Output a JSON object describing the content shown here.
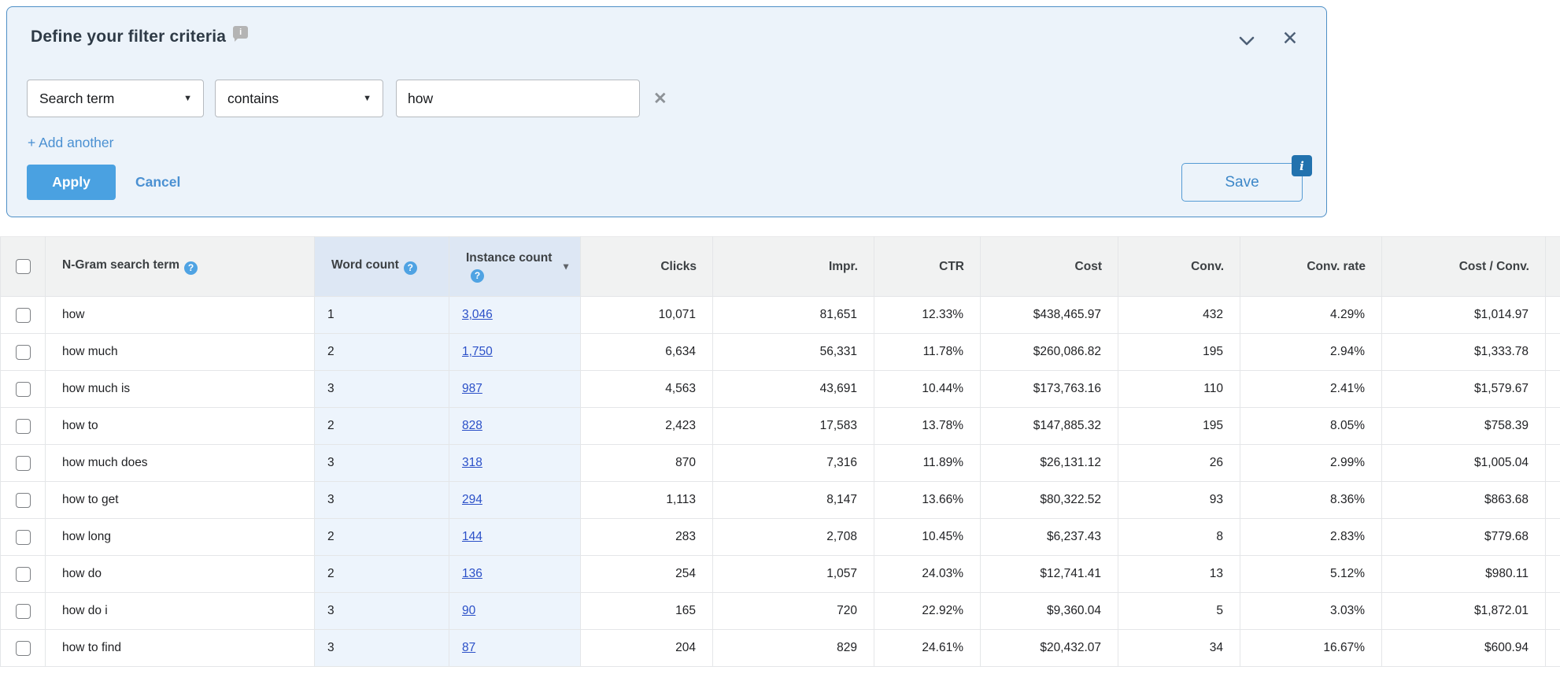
{
  "filter_panel": {
    "title": "Define your filter criteria",
    "criteria_row": {
      "field": "Search term",
      "operator": "contains",
      "value": "how"
    },
    "add_another_label": "+ Add another",
    "apply_label": "Apply",
    "cancel_label": "Cancel",
    "save_label": "Save"
  },
  "icons": {
    "help": "?",
    "info": "i",
    "save_info": "i",
    "sort_desc": "▼",
    "dropdown_arrow": "▼",
    "close": "✕",
    "remove": "✕"
  },
  "colors": {
    "panel_bg": "#ecf3fa",
    "panel_border": "#4e8fc6",
    "accent_blue": "#4a90d2",
    "apply_bg": "#4aa1e1",
    "table_link": "#2b50c8",
    "header_bg": "#f1f2f2",
    "highlight_col_header": "#dde7f4",
    "highlight_col_body": "#edf4fc"
  },
  "table": {
    "header": {
      "term": "N-Gram search term",
      "word_count": "Word count",
      "instance_count": "Instance count",
      "clicks": "Clicks",
      "impr": "Impr.",
      "ctr": "CTR",
      "cost": "Cost",
      "conv": "Conv.",
      "conv_rate": "Conv. rate",
      "cost_conv": "Cost / Conv."
    },
    "rows": [
      {
        "term": "how",
        "word_count": "1",
        "instance_count": "3,046",
        "clicks": "10,071",
        "impr": "81,651",
        "ctr": "12.33%",
        "cost": "$438,465.97",
        "conv": "432",
        "conv_rate": "4.29%",
        "cost_conv": "$1,014.97"
      },
      {
        "term": "how much",
        "word_count": "2",
        "instance_count": "1,750",
        "clicks": "6,634",
        "impr": "56,331",
        "ctr": "11.78%",
        "cost": "$260,086.82",
        "conv": "195",
        "conv_rate": "2.94%",
        "cost_conv": "$1,333.78"
      },
      {
        "term": "how much is",
        "word_count": "3",
        "instance_count": "987",
        "clicks": "4,563",
        "impr": "43,691",
        "ctr": "10.44%",
        "cost": "$173,763.16",
        "conv": "110",
        "conv_rate": "2.41%",
        "cost_conv": "$1,579.67"
      },
      {
        "term": "how to",
        "word_count": "2",
        "instance_count": "828",
        "clicks": "2,423",
        "impr": "17,583",
        "ctr": "13.78%",
        "cost": "$147,885.32",
        "conv": "195",
        "conv_rate": "8.05%",
        "cost_conv": "$758.39"
      },
      {
        "term": "how much does",
        "word_count": "3",
        "instance_count": "318",
        "clicks": "870",
        "impr": "7,316",
        "ctr": "11.89%",
        "cost": "$26,131.12",
        "conv": "26",
        "conv_rate": "2.99%",
        "cost_conv": "$1,005.04"
      },
      {
        "term": "how to get",
        "word_count": "3",
        "instance_count": "294",
        "clicks": "1,113",
        "impr": "8,147",
        "ctr": "13.66%",
        "cost": "$80,322.52",
        "conv": "93",
        "conv_rate": "8.36%",
        "cost_conv": "$863.68"
      },
      {
        "term": "how long",
        "word_count": "2",
        "instance_count": "144",
        "clicks": "283",
        "impr": "2,708",
        "ctr": "10.45%",
        "cost": "$6,237.43",
        "conv": "8",
        "conv_rate": "2.83%",
        "cost_conv": "$779.68"
      },
      {
        "term": "how do",
        "word_count": "2",
        "instance_count": "136",
        "clicks": "254",
        "impr": "1,057",
        "ctr": "24.03%",
        "cost": "$12,741.41",
        "conv": "13",
        "conv_rate": "5.12%",
        "cost_conv": "$980.11"
      },
      {
        "term": "how do i",
        "word_count": "3",
        "instance_count": "90",
        "clicks": "165",
        "impr": "720",
        "ctr": "22.92%",
        "cost": "$9,360.04",
        "conv": "5",
        "conv_rate": "3.03%",
        "cost_conv": "$1,872.01"
      },
      {
        "term": "how to find",
        "word_count": "3",
        "instance_count": "87",
        "clicks": "204",
        "impr": "829",
        "ctr": "24.61%",
        "cost": "$20,432.07",
        "conv": "34",
        "conv_rate": "16.67%",
        "cost_conv": "$600.94"
      }
    ]
  }
}
